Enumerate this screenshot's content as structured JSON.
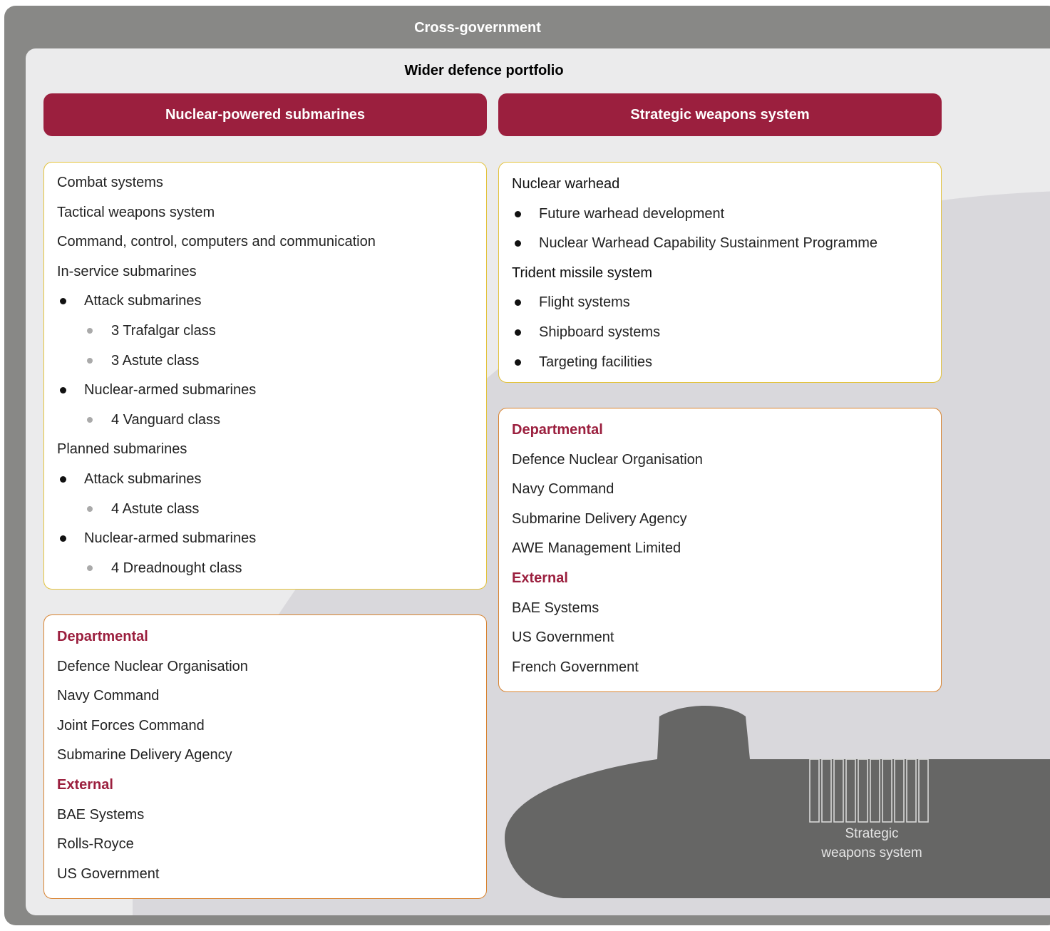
{
  "outer_title": "Cross-government",
  "inner_title": "Wider defence portfolio",
  "headers": {
    "left": "Nuclear-powered submarines",
    "right": "Strategic weapons system"
  },
  "left_programmes": [
    {
      "text": "Combat systems",
      "level": 0
    },
    {
      "text": "Tactical weapons system",
      "level": 0
    },
    {
      "text": "Command, control, computers and communication",
      "level": 0
    },
    {
      "text": "In-service submarines",
      "level": 0
    },
    {
      "text": "Attack submarines",
      "level": 1
    },
    {
      "text": "3 Trafalgar class",
      "level": 2
    },
    {
      "text": "3 Astute class",
      "level": 2
    },
    {
      "text": "Nuclear-armed submarines",
      "level": 1
    },
    {
      "text": "4 Vanguard class",
      "level": 2
    },
    {
      "text": "Planned submarines",
      "level": 0
    },
    {
      "text": "Attack submarines",
      "level": 1
    },
    {
      "text": "4 Astute class",
      "level": 2
    },
    {
      "text": "Nuclear-armed submarines",
      "level": 1
    },
    {
      "text": "4 Dreadnought class",
      "level": 2
    }
  ],
  "right_programmes": [
    {
      "text": "Nuclear warhead",
      "level": 0
    },
    {
      "text": "Future warhead development",
      "level": 1
    },
    {
      "text": "Nuclear Warhead Capability Sustainment Programme",
      "level": 1
    },
    {
      "text": "Trident missile system",
      "level": 0
    },
    {
      "text": "Flight systems",
      "level": 1
    },
    {
      "text": "Shipboard systems",
      "level": 1
    },
    {
      "text": "Targeting facilities",
      "level": 1
    }
  ],
  "left_organisations": [
    {
      "text": "Departmental",
      "heading": true
    },
    {
      "text": "Defence Nuclear Organisation"
    },
    {
      "text": "Navy Command"
    },
    {
      "text": "Joint Forces Command"
    },
    {
      "text": "Submarine Delivery Agency"
    },
    {
      "text": "External",
      "heading": true
    },
    {
      "text": "BAE Systems"
    },
    {
      "text": "Rolls-Royce"
    },
    {
      "text": "US Government"
    }
  ],
  "right_organisations": [
    {
      "text": "Departmental",
      "heading": true
    },
    {
      "text": "Defence Nuclear Organisation"
    },
    {
      "text": "Navy Command"
    },
    {
      "text": "Submarine Delivery Agency"
    },
    {
      "text": "AWE Management Limited"
    },
    {
      "text": "External",
      "heading": true
    },
    {
      "text": "BAE Systems"
    },
    {
      "text": "US Government"
    },
    {
      "text": "French Government"
    }
  ],
  "submarine_label": [
    "Strategic",
    "weapons system"
  ],
  "colors": {
    "header": "#9b1f3e",
    "heading_text": "#9b1f3e",
    "outer": "#888886",
    "inner": "#ebebec",
    "submarine": "#666665",
    "programme_border": "#e3c23a",
    "organisation_border": "#d8822e"
  }
}
